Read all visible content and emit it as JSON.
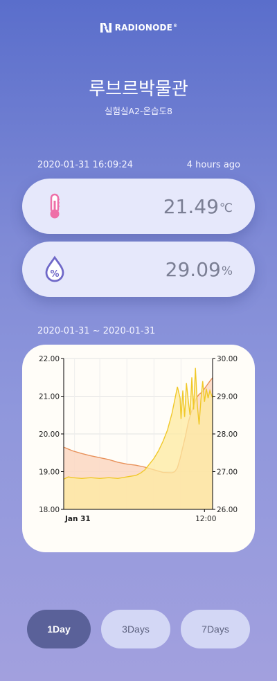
{
  "brand": {
    "name": "RADIONODE",
    "reg": "®"
  },
  "location": {
    "title": "루브르박물관",
    "subtitle": "실험실A2-온습도8"
  },
  "status": {
    "timestamp": "2020-01-31 16:09:24",
    "age": "4 hours ago"
  },
  "readings": {
    "temperature": {
      "value": "21.49",
      "unit": "℃",
      "icon": "thermometer-icon",
      "color": "#ee6fa8"
    },
    "humidity": {
      "value": "29.09",
      "unit": "%",
      "icon": "humidity-drop-icon",
      "color": "#6f68c8"
    }
  },
  "range_label": "2020-01-31 ~ 2020-01-31",
  "chart_data": {
    "type": "area",
    "x_ticks": [
      "Jan 31",
      "12:00"
    ],
    "y_left": {
      "min": 18,
      "max": 22,
      "ticks": [
        "18.00",
        "19.00",
        "20.00",
        "21.00",
        "22.00"
      ]
    },
    "y_right": {
      "min": 26,
      "max": 30,
      "ticks": [
        "26.00",
        "27.00",
        "28.00",
        "29.00",
        "30.00"
      ]
    },
    "grid": true,
    "x_range_hours": [
      0,
      16.5
    ],
    "series": [
      {
        "axis": "left",
        "color": "#e8915a",
        "fill": "#fbd7c2",
        "x": [
          0,
          0.5,
          1,
          2,
          3,
          4,
          5,
          6,
          7,
          8,
          9,
          10,
          11,
          12,
          12.3,
          12.6,
          12.9,
          13.2,
          13.5,
          13.8,
          14.1,
          14.4,
          14.7,
          15,
          15.3,
          15.6,
          15.9,
          16.2,
          16.5
        ],
        "y": [
          19.65,
          19.6,
          19.55,
          19.48,
          19.42,
          19.37,
          19.32,
          19.25,
          19.2,
          19.17,
          19.12,
          19.05,
          18.98,
          18.97,
          19.0,
          19.1,
          19.35,
          19.65,
          19.95,
          20.3,
          20.55,
          20.75,
          20.95,
          21.05,
          21.1,
          21.2,
          21.3,
          21.4,
          21.49
        ]
      },
      {
        "axis": "right",
        "color": "#f0c828",
        "fill": "#fde9a0",
        "x": [
          0,
          0.5,
          1,
          2,
          3,
          4,
          5,
          6,
          7,
          8,
          8.5,
          9,
          9.5,
          10,
          10.5,
          11,
          11.5,
          12,
          12.3,
          12.6,
          12.9,
          13,
          13.2,
          13.4,
          13.6,
          13.8,
          14,
          14.2,
          14.4,
          14.6,
          14.8,
          15,
          15.2,
          15.4,
          15.6,
          15.8,
          16,
          16.2,
          16.5
        ],
        "y": [
          26.8,
          26.86,
          26.84,
          26.82,
          26.84,
          26.82,
          26.84,
          26.82,
          26.86,
          26.9,
          26.96,
          27.05,
          27.2,
          27.35,
          27.55,
          27.8,
          28.1,
          28.55,
          28.9,
          29.25,
          28.95,
          28.4,
          29.15,
          28.45,
          29.35,
          28.9,
          28.5,
          29.5,
          28.65,
          29.75,
          28.8,
          28.25,
          28.9,
          29.4,
          28.85,
          29.2,
          28.95,
          29.15,
          28.95
        ]
      }
    ]
  },
  "range_buttons": [
    {
      "label": "1Day",
      "active": true
    },
    {
      "label": "3Days",
      "active": false
    },
    {
      "label": "7Days",
      "active": false
    }
  ]
}
